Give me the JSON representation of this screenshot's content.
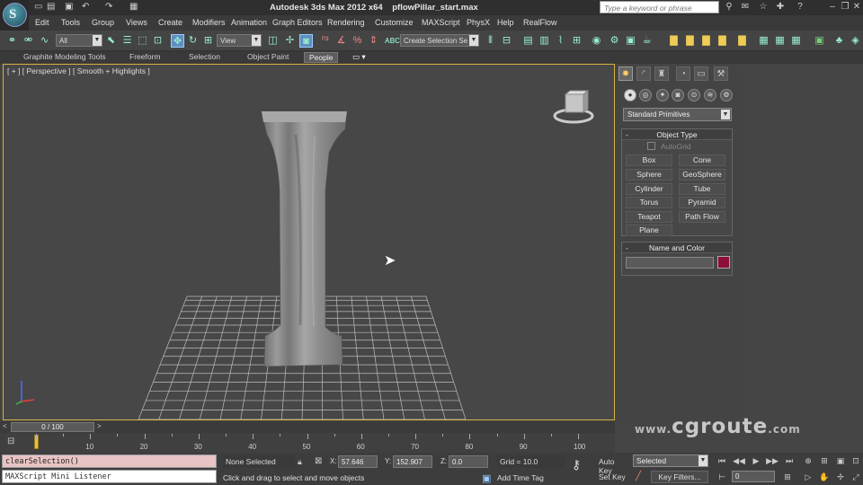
{
  "window": {
    "app_title": "Autodesk 3ds Max  2012 x64",
    "file_name": "pflowPillar_start.max",
    "search_placeholder": "Type a keyword or phrase"
  },
  "menu": [
    "Edit",
    "Tools",
    "Group",
    "Views",
    "Create",
    "Modifiers",
    "Animation",
    "Graph Editors",
    "Rendering",
    "Customize",
    "MAXScript",
    "PhysX",
    "Help",
    "RealFlow"
  ],
  "toolbar": {
    "selection_filter": "All",
    "reference_coord": "View",
    "named_selection_placeholder": "Create Selection Se"
  },
  "ribbon_tabs": [
    {
      "label": "Graphite Modeling Tools",
      "active": false
    },
    {
      "label": "Freeform",
      "active": false
    },
    {
      "label": "Selection",
      "active": false
    },
    {
      "label": "Object Paint",
      "active": false
    },
    {
      "label": "People",
      "active": true
    }
  ],
  "viewport": {
    "label": "[ + ] [ Perspective ] [ Smooth + Highlights ]"
  },
  "command_panel": {
    "category_dropdown": "Standard Primitives",
    "object_type": {
      "title": "Object Type",
      "autogrid_label": "AutoGrid",
      "buttons": [
        "Box",
        "Cone",
        "Sphere",
        "GeoSphere",
        "Cylinder",
        "Tube",
        "Torus",
        "Pyramid",
        "Teapot",
        "Path Flow",
        "Plane"
      ]
    },
    "name_and_color": {
      "title": "Name and Color",
      "name_value": "",
      "color": "#8c1038"
    }
  },
  "timeline": {
    "slider_label": "0 / 100",
    "ticks": [
      "10",
      "20",
      "30",
      "40",
      "50",
      "60",
      "70",
      "80",
      "90",
      "100"
    ]
  },
  "status": {
    "maxscript_command": "clearSelection()",
    "maxscript_listener": "MAXScript Mini Listener",
    "selection_status": "None Selected",
    "prompt": "Click and drag to select and move objects",
    "x_label": "X:",
    "x_value": "57.646",
    "y_label": "Y:",
    "y_value": "152.907",
    "z_label": "Z:",
    "z_value": "0.0",
    "grid": "Grid = 10.0",
    "add_time_tag": "Add Time Tag",
    "auto_key": "Auto Key",
    "set_key": "Set Key",
    "key_mode": "Selected",
    "key_filters": "Key Filters...",
    "current_frame": "0"
  },
  "watermark": {
    "prefix": "www.",
    "brand": "cgroute",
    "suffix": ".com"
  },
  "colors": {
    "viewport_border": "#d8b040",
    "scrubber": "#e8c040",
    "maxscript_bg": "#e8c4c4"
  }
}
